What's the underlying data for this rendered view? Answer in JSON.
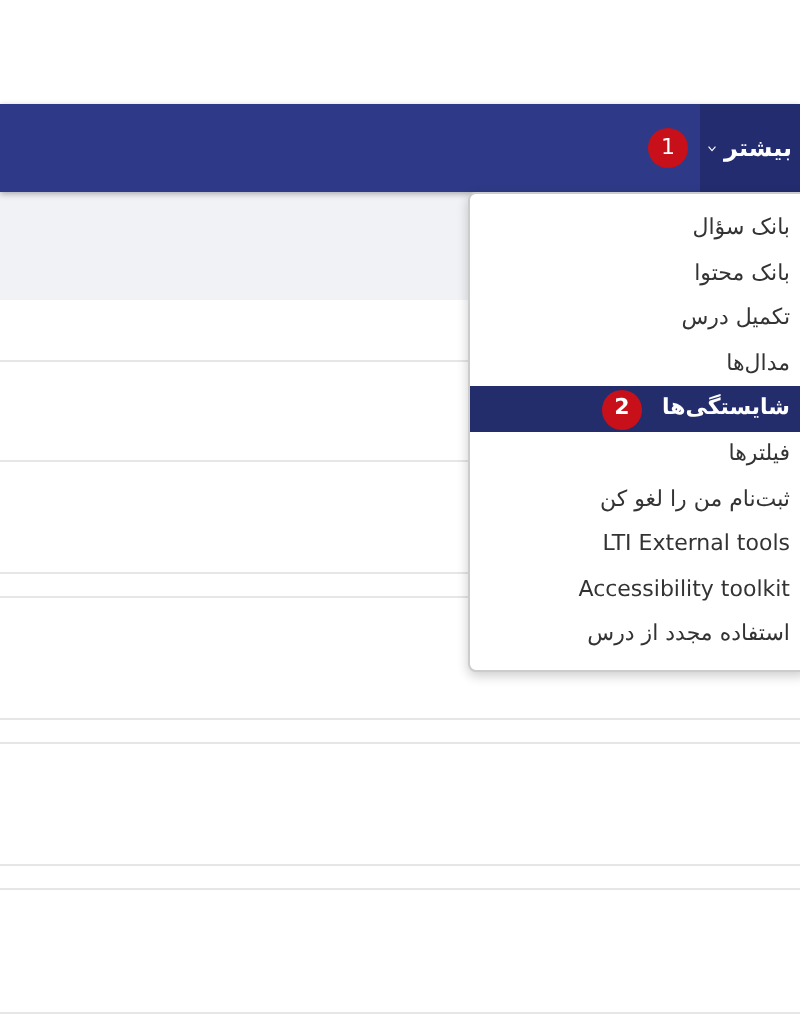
{
  "navbar": {
    "more_tab": {
      "label": "بیشتر",
      "selected": true,
      "badge": "1"
    }
  },
  "dropdown": {
    "items": [
      {
        "label": "بانک سؤال",
        "selected": false
      },
      {
        "label": "بانک محتوا",
        "selected": false
      },
      {
        "label": "تکمیل درس",
        "selected": false
      },
      {
        "label": "مدال‌ها",
        "selected": false
      },
      {
        "label": "شایستگی‌ها",
        "selected": true,
        "badge": "2"
      },
      {
        "label": "فیلترها",
        "selected": false
      },
      {
        "label": "ثبت‌نام من را لغو کن",
        "selected": false
      },
      {
        "label": "LTI External tools",
        "selected": false
      },
      {
        "label": "Accessibility toolkit",
        "selected": false
      },
      {
        "label": "استفاده مجدد از درس",
        "selected": false
      }
    ]
  }
}
